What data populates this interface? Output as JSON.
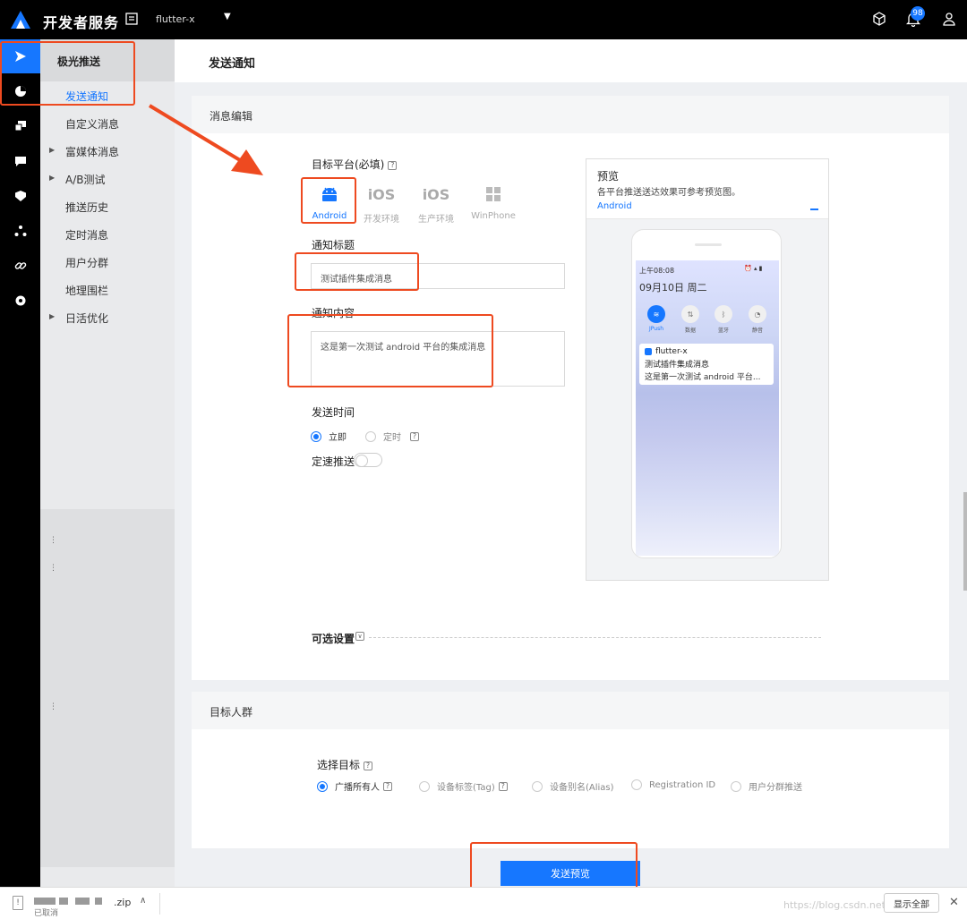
{
  "topbar": {
    "brand": "开发者服务",
    "app_name": "flutter-x",
    "notification_count": "98"
  },
  "subnav": {
    "title": "极光推送",
    "items": [
      {
        "label": "发送通知",
        "active": true,
        "caret": false
      },
      {
        "label": "自定义消息",
        "caret": false
      },
      {
        "label": "富媒体消息",
        "caret": true
      },
      {
        "label": "A/B测试",
        "caret": true
      },
      {
        "label": "推送历史",
        "caret": false
      },
      {
        "label": "定时消息",
        "caret": false
      },
      {
        "label": "用户分群",
        "caret": false
      },
      {
        "label": "地理围栏",
        "caret": false
      },
      {
        "label": "日活优化",
        "caret": true
      }
    ]
  },
  "main": {
    "title": "发送通知"
  },
  "message_edit": {
    "section_title": "消息编辑",
    "platform_label": "目标平台(必填)",
    "platforms": [
      {
        "name": "Android",
        "glyph": "",
        "active": true
      },
      {
        "name": "开发环境",
        "glyph": "iOS"
      },
      {
        "name": "生产环境",
        "glyph": "iOS"
      },
      {
        "name": "WinPhone",
        "glyph": ""
      }
    ],
    "title_label": "通知标题",
    "title_value": "测试插件集成消息",
    "content_label": "通知内容",
    "content_value": "这是第一次测试 android 平台的集成消息",
    "send_time_label": "发送时间",
    "send_time_options": [
      "立即",
      "定时"
    ],
    "rate_label": "定速推送",
    "optional_label": "可选设置"
  },
  "preview": {
    "title": "预览",
    "subtitle": "各平台推送送达效果可参考预览图。",
    "tab": "Android",
    "phone": {
      "time": "上午08:08",
      "date": "09月10日  周二",
      "quick_settings": [
        "JPush",
        "数据",
        "蓝牙",
        "静音"
      ],
      "notif_app": "flutter-x",
      "notif_title": "测试插件集成消息",
      "notif_body": "这是第一次测试 android 平台..."
    }
  },
  "audience": {
    "section_title": "目标人群",
    "select_label": "选择目标",
    "options": [
      "广播所有人",
      "设备标签(Tag)",
      "设备别名(Alias)",
      "Registration ID",
      "用户分群推送"
    ]
  },
  "send_button": "发送预览",
  "download": {
    "ext": ".zip",
    "status": "已取消",
    "show_all": "显示全部"
  },
  "watermark": "https://blog.csdn.net/..."
}
